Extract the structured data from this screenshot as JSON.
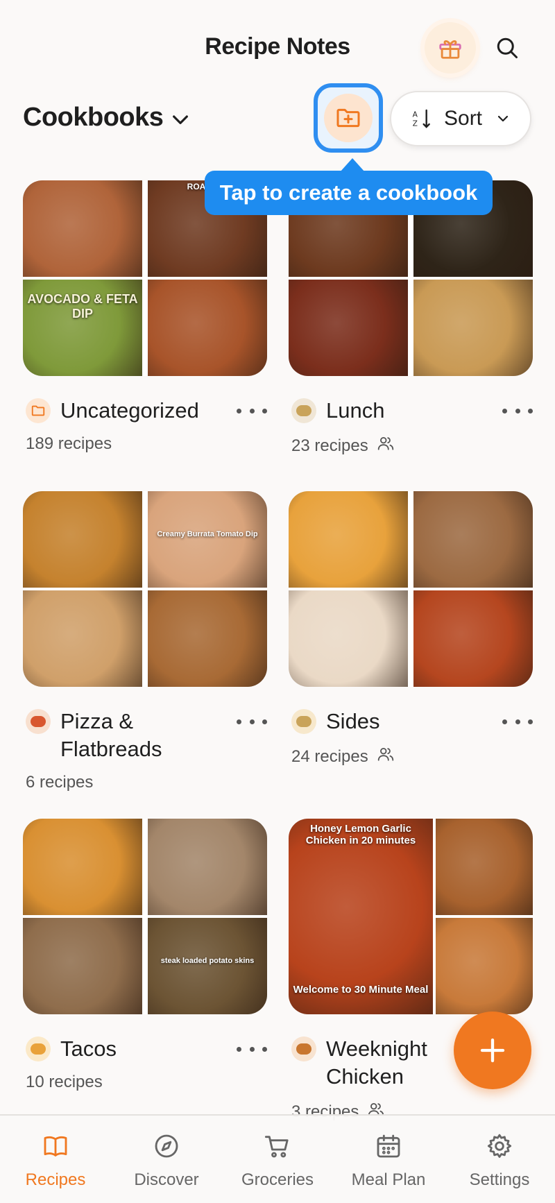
{
  "header": {
    "title": "Recipe Notes"
  },
  "section": {
    "title": "Cookbooks"
  },
  "sort": {
    "label": "Sort"
  },
  "tooltip": {
    "text": "Tap to create a cookbook"
  },
  "cookbooks": [
    {
      "name": "Uncategorized",
      "icon": "folder-icon",
      "count": "189 recipes",
      "shared": false,
      "tiles": [
        {
          "color": "#b0643a",
          "label": ""
        },
        {
          "color": "#6f3b22",
          "label": "ROASTED"
        },
        {
          "color": "#7f9a3a",
          "label": "AVOCADO & FETA DIP"
        },
        {
          "color": "#a8542a",
          "label": ""
        }
      ]
    },
    {
      "name": "Lunch",
      "icon": "burrito-icon",
      "count": "23 recipes",
      "shared": true,
      "tiles": [
        {
          "color": "#6d3a1f",
          "label": ""
        },
        {
          "color": "#2e2418",
          "label": ""
        },
        {
          "color": "#7b2e1c",
          "label": ""
        },
        {
          "color": "#c99a55",
          "label": ""
        }
      ]
    },
    {
      "name": "Pizza & Flatbreads",
      "icon": "pizza-icon",
      "count": "6 recipes",
      "shared": false,
      "tiles": [
        {
          "color": "#c5822e",
          "label": ""
        },
        {
          "color": "#d9a47c",
          "label": "Creamy Burrata Tomato Dip"
        },
        {
          "color": "#d0a06a",
          "label": ""
        },
        {
          "color": "#a86a35",
          "label": ""
        }
      ]
    },
    {
      "name": "Sides",
      "icon": "potato-icon",
      "count": "24 recipes",
      "shared": true,
      "tiles": [
        {
          "color": "#e8a23c",
          "label": ""
        },
        {
          "color": "#9c6a42",
          "label": ""
        },
        {
          "color": "#ead9c6",
          "label": ""
        },
        {
          "color": "#b5461f",
          "label": ""
        }
      ]
    },
    {
      "name": "Tacos",
      "icon": "taco-icon",
      "count": "10 recipes",
      "shared": false,
      "tiles": [
        {
          "color": "#d99032",
          "label": ""
        },
        {
          "color": "#a3866a",
          "label": ""
        },
        {
          "color": "#8f6d4c",
          "label": ""
        },
        {
          "color": "#6c5434",
          "label": "steak loaded potato skins"
        }
      ]
    },
    {
      "name": "Weeknight Chicken",
      "icon": "chicken-icon",
      "count": "3 recipes",
      "shared": true,
      "tiles": [
        {
          "color": "#b8431c",
          "label": "Honey Lemon Garlic Chicken in 20 minutes"
        },
        {
          "color": "#a8622e",
          "label": ""
        },
        {
          "color": "#c87a3a",
          "label": ""
        },
        {
          "color": "#333333",
          "label": "Welcome to 30 Minute Meal"
        }
      ]
    }
  ],
  "nav": [
    {
      "label": "Recipes",
      "icon": "book-icon",
      "active": true
    },
    {
      "label": "Discover",
      "icon": "compass-icon",
      "active": false
    },
    {
      "label": "Groceries",
      "icon": "cart-icon",
      "active": false
    },
    {
      "label": "Meal Plan",
      "icon": "calendar-icon",
      "active": false
    },
    {
      "label": "Settings",
      "icon": "gear-icon",
      "active": false
    }
  ],
  "colors": {
    "accent": "#f07820",
    "tooltip": "#1e8cf0",
    "background": "#fbf9f8"
  }
}
